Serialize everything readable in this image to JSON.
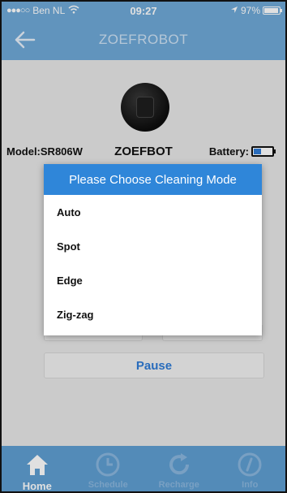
{
  "status_bar": {
    "signal": "●●●○○",
    "carrier": "Ben NL",
    "wifi_icon": "wifi-icon",
    "time": "09:27",
    "location_icon": "location-arrow-icon",
    "battery_percent": "97%",
    "battery_level": 0.97
  },
  "nav": {
    "title": "ZOEFROBOT",
    "back_icon": "arrow-left-icon"
  },
  "device": {
    "model": "Model:SR806W",
    "brand": "ZOEFBOT",
    "battery_label": "Battery:",
    "battery_level": 0.4
  },
  "pause_label": "Pause",
  "dialog": {
    "title": "Please Choose Cleaning Mode",
    "modes": [
      "Auto",
      "Spot",
      "Edge",
      "Zig-zag"
    ]
  },
  "tabs": [
    {
      "label": "Home",
      "icon": "home-icon"
    },
    {
      "label": "Schedule",
      "icon": "clock-icon"
    },
    {
      "label": "Recharge",
      "icon": "refresh-icon"
    },
    {
      "label": "Info",
      "icon": "info-icon"
    }
  ],
  "colors": {
    "header_blue": "#6fa9d8",
    "dialog_blue": "#2f86d9",
    "tab_bar": "#5f9fd2",
    "accent": "#2f7cd6"
  }
}
